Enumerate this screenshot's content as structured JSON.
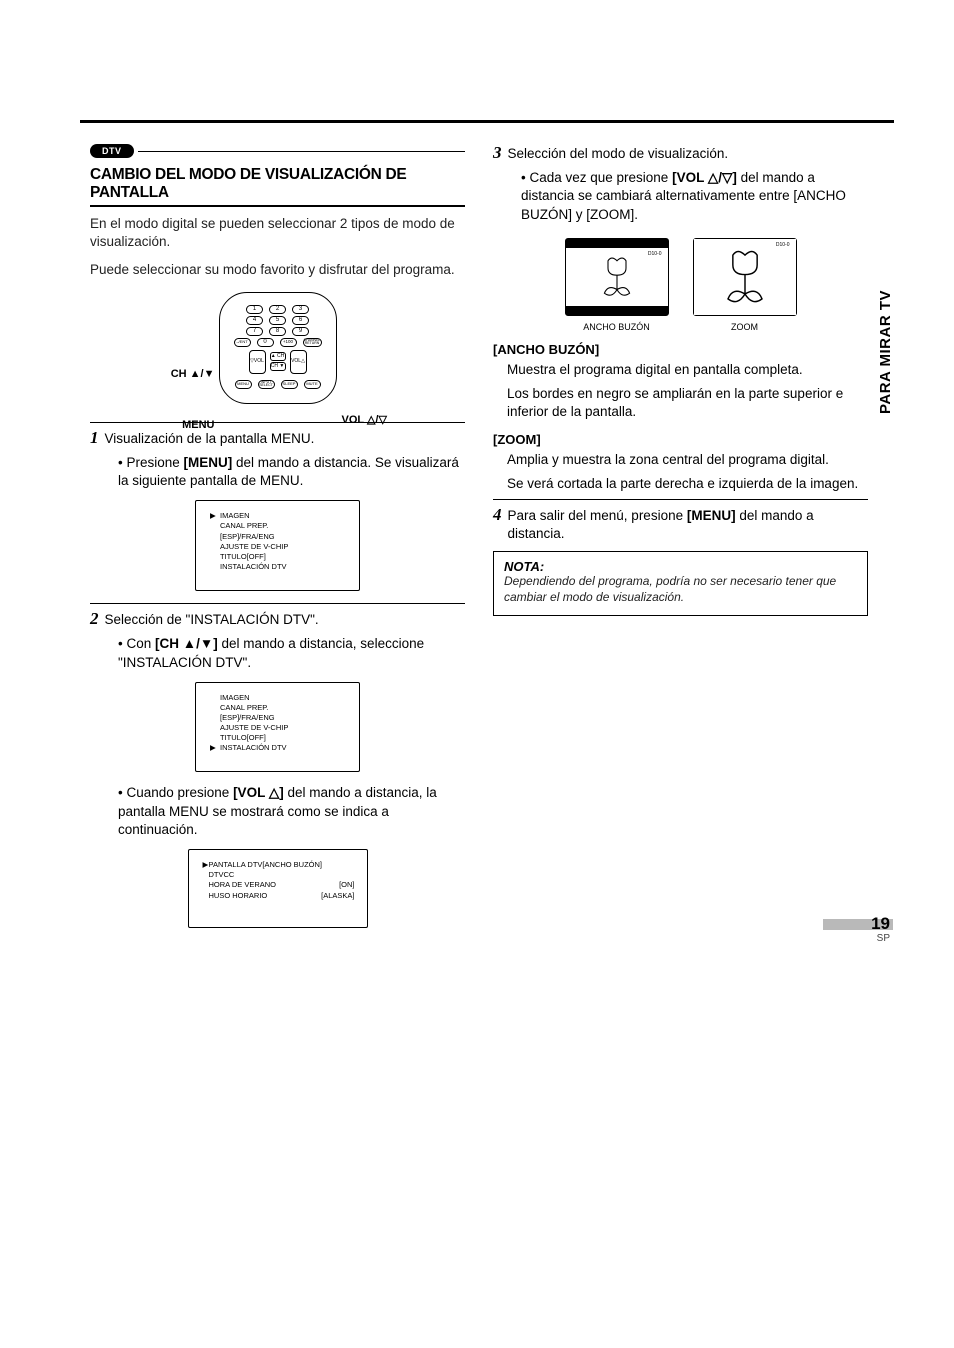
{
  "badge": "DTV",
  "side_tab": "PARA MIRAR TV",
  "page_number": "19",
  "page_region": "SP",
  "section_title": "CAMBIO DEL MODO DE VISUALIZACIÓN DE PANTALLA",
  "intro1": "En el modo digital se pueden seleccionar 2 tipos de modo de visualización.",
  "intro2": "Puede seleccionar su modo favorito y disfrutar del programa.",
  "remote": {
    "label_ch": "CH ▲/▼",
    "label_menu": "MENU",
    "label_vol": "VOL △/▽",
    "nums": [
      "1",
      "2",
      "3",
      "4",
      "5",
      "6",
      "7",
      "8",
      "9",
      "0",
      "+100"
    ],
    "ent": "–/ENT",
    "chret": "CHANNEL RETURN",
    "menu_b": "MENU",
    "input": "INPUT SELECT",
    "sleep": "SLEEP",
    "mute": "MUTE",
    "vol_l": "▽VOL",
    "vol_r": "VOL△",
    "ch_u": "▲ CH",
    "ch_d": "CH ▼"
  },
  "step1": {
    "num": "1",
    "head": "Visualización de la pantalla MENU.",
    "bullet": "Presione [MENU] del mando a distancia. Se visualizará la siguiente pantalla de MENU.",
    "bullet_prefix": "• Presione ",
    "bullet_bold": "[MENU]",
    "bullet_rest": " del mando a distancia. Se visualizará la siguiente pantalla de MENU.",
    "menu_items": [
      "IMAGEN",
      "CANAL PREP.",
      "[ESP]/FRA/ENG",
      "AJUSTE DE V-CHIP",
      "TITULO[OFF]",
      "INSTALACIÓN DTV"
    ],
    "selected_index": 0
  },
  "step2": {
    "num": "2",
    "head": "Selección de \"INSTALACIÓN DTV\".",
    "bullet_line": "• Con [CH ▲/▼] del mando a distancia, seleccione \"INSTALACIÓN DTV\".",
    "b_prefix": "• Con ",
    "b_bold": "[CH ▲/▼]",
    "b_rest": " del mando a distancia, seleccione \"INSTALACIÓN DTV\".",
    "menu_items": [
      "IMAGEN",
      "CANAL PREP.",
      "[ESP]/FRA/ENG",
      "AJUSTE DE V-CHIP",
      "TITULO[OFF]",
      "INSTALACIÓN DTV"
    ],
    "selected_index": 5,
    "second_bullet_pre": "• Cuando presione ",
    "second_bullet_bold": "[VOL △]",
    "second_bullet_rest": " del mando a distancia, la pantalla MENU se mostrará como se indica a continuación.",
    "menu3": [
      {
        "l": "PANTALLA DTV[ANCHO BUZÓN]",
        "v": ""
      },
      {
        "l": "DTVCC",
        "v": ""
      },
      {
        "l": "HORA DE VERANO",
        "v": "[ON]"
      },
      {
        "l": "HUSO HORARIO",
        "v": "[ALASKA]"
      }
    ],
    "menu3_selected": 0
  },
  "step3": {
    "num": "3",
    "head": "Selección del modo de visualización.",
    "b_prefix": "• Cada vez que presione ",
    "b_bold": "[VOL △/▽]",
    "b_rest": " del mando a distancia se cambiará alternativamente entre [ANCHO BUZÓN] y [ZOOM].",
    "preview_ancho": "ANCHO BUZÓN",
    "preview_zoom": "ZOOM",
    "badge_d100": "D10-0",
    "ancho_head": "[ANCHO BUZÓN]",
    "ancho_p1": "Muestra el programa digital en pantalla completa.",
    "ancho_p2": "Los bordes en negro se ampliarán en la parte superior e inferior de la pantalla.",
    "zoom_head": "[ZOOM]",
    "zoom_p1": "Amplia y muestra la zona central del programa digital.",
    "zoom_p2": "Se verá cortada la parte derecha e izquierda de la imagen."
  },
  "step4": {
    "num": "4",
    "text_pre": "Para salir del menú, presione ",
    "text_bold": "[MENU]",
    "text_rest": " del mando a distancia."
  },
  "note": {
    "title": "NOTA:",
    "body": "Dependiendo del programa, podría no ser necesario tener que cambiar el modo de visualización."
  }
}
